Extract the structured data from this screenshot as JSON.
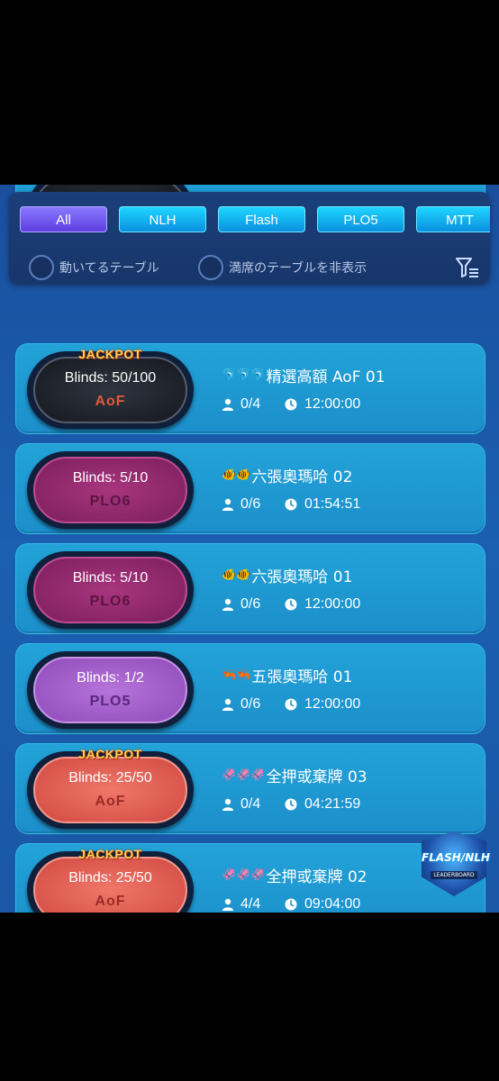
{
  "tabs": [
    {
      "label": "All",
      "active": true
    },
    {
      "label": "NLH",
      "active": false
    },
    {
      "label": "Flash",
      "active": false
    },
    {
      "label": "PLO5",
      "active": false
    },
    {
      "label": "MTT",
      "active": false
    }
  ],
  "toggles": {
    "running_label": "動いてるテーブル",
    "hide_full_label": "満席のテーブルを非表示"
  },
  "tables": [
    {
      "blinds": "Blinds: 50/100",
      "game": "AoF",
      "style": "aof-dark",
      "jackpot": "",
      "emoji": "",
      "name": "",
      "seats": "0/4",
      "time": "12:00:00"
    },
    {
      "blinds": "Blinds: 50/100",
      "game": "AoF",
      "style": "aof-dark",
      "jackpot": "JACKPOT",
      "emoji": "🐬🐬🐬",
      "name": "精選高額 AoF 01",
      "seats": "0/4",
      "time": "12:00:00"
    },
    {
      "blinds": "Blinds: 5/10",
      "game": "PLO6",
      "style": "plo6",
      "jackpot": "",
      "emoji": "🐠🐠",
      "name": "六張奧瑪哈 02",
      "seats": "0/6",
      "time": "01:54:51"
    },
    {
      "blinds": "Blinds: 5/10",
      "game": "PLO6",
      "style": "plo6",
      "jackpot": "",
      "emoji": "🐠🐠",
      "name": "六張奧瑪哈 01",
      "seats": "0/6",
      "time": "12:00:00"
    },
    {
      "blinds": "Blinds: 1/2",
      "game": "PLO5",
      "style": "plo5",
      "jackpot": "",
      "emoji": "🦐🦐",
      "name": "五張奧瑪哈 01",
      "seats": "0/6",
      "time": "12:00:00"
    },
    {
      "blinds": "Blinds: 25/50",
      "game": "AoF",
      "style": "aof-red",
      "jackpot": "JACKPOT",
      "emoji": "🦑🦑🦑",
      "name": "全押或棄牌 03",
      "seats": "0/4",
      "time": "04:21:59"
    },
    {
      "blinds": "Blinds: 25/50",
      "game": "AoF",
      "style": "aof-red",
      "jackpot": "JACKPOT",
      "emoji": "🦑🦑🦑",
      "name": "全押或棄牌 02",
      "seats": "4/4",
      "time": "09:04:00"
    }
  ],
  "leaderboard": {
    "title": "FLASH/NLH",
    "subtitle": "LEADERBOARD"
  },
  "icons": {
    "radio": "radio-unchecked-icon",
    "filter": "filter-icon",
    "seats": "person-icon",
    "time": "clock-icon"
  },
  "colors": {
    "accent": "#5c3fe0",
    "tab": "#0a8fe0",
    "card": "#1c8fcb"
  }
}
